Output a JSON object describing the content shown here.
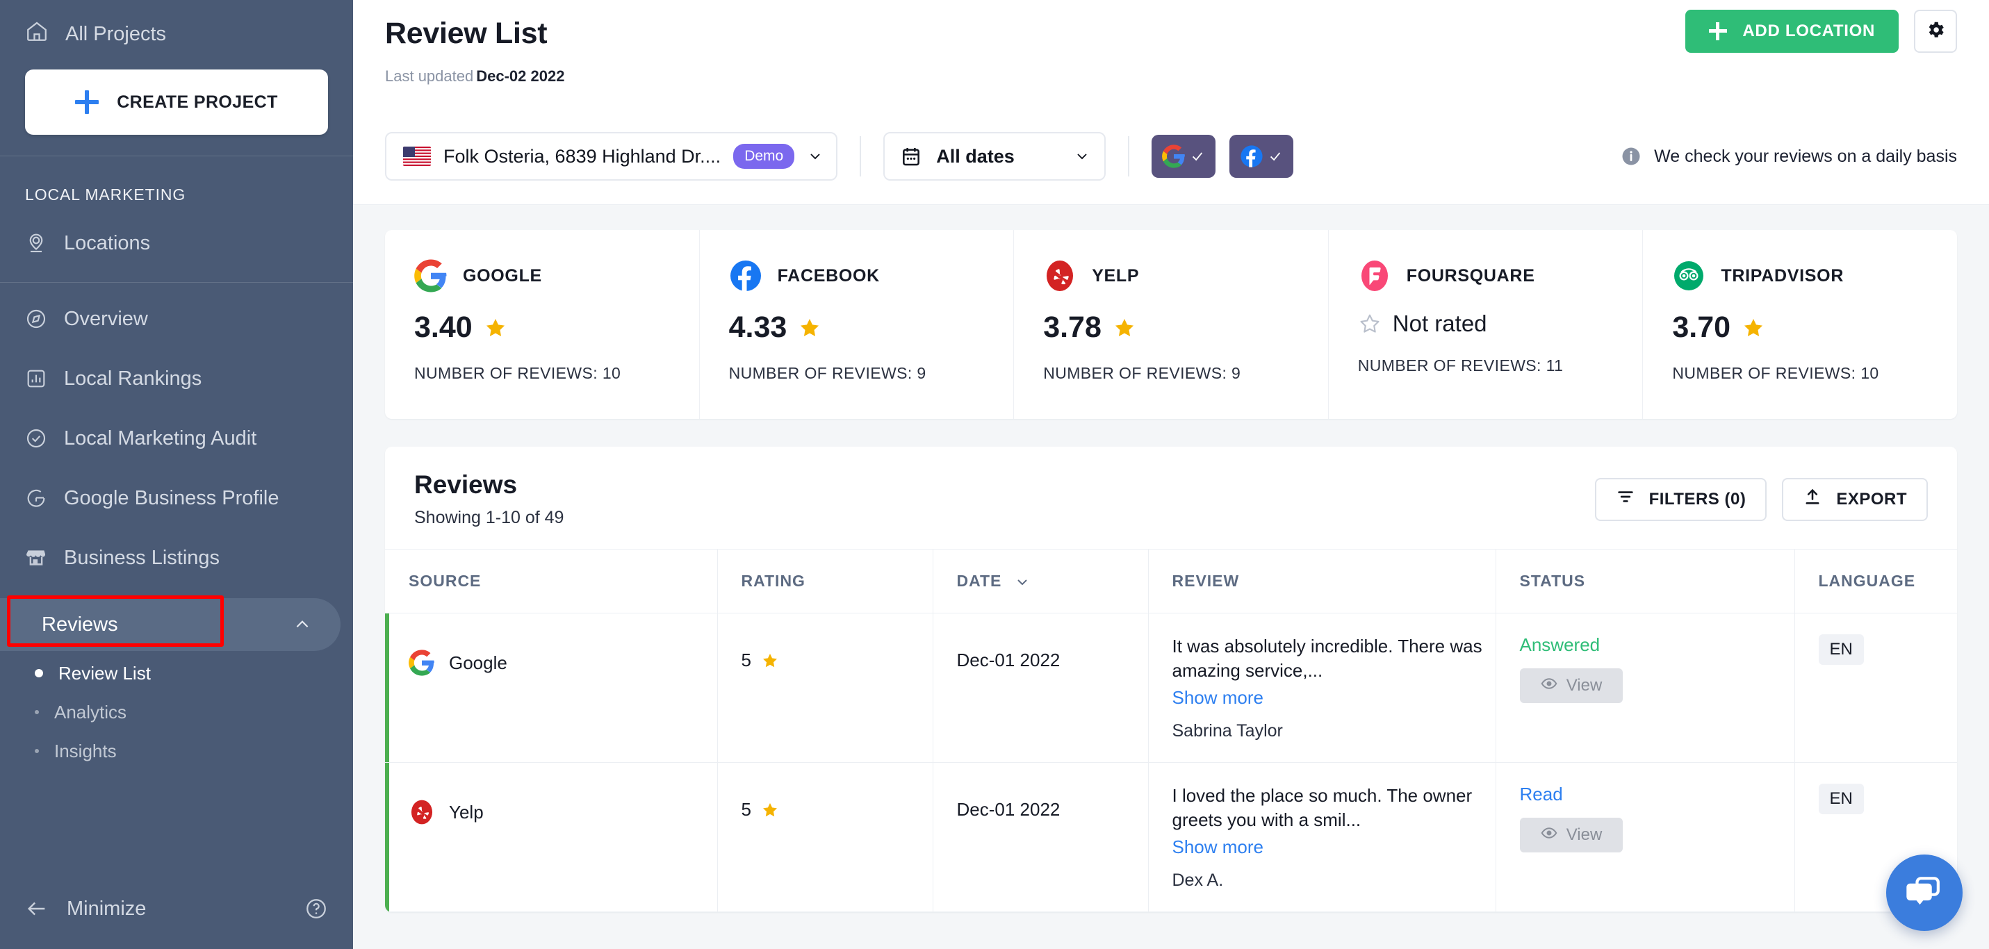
{
  "sidebar": {
    "all_projects": "All Projects",
    "create_project": "CREATE PROJECT",
    "section_label": "LOCAL MARKETING",
    "locations": "Locations",
    "items": [
      {
        "label": "Overview"
      },
      {
        "label": "Local Rankings"
      },
      {
        "label": "Local Marketing Audit"
      },
      {
        "label": "Google Business Profile"
      },
      {
        "label": "Business Listings"
      }
    ],
    "active_item": "Reviews",
    "sub_items": [
      {
        "label": "Review List",
        "current": true
      },
      {
        "label": "Analytics",
        "current": false
      },
      {
        "label": "Insights",
        "current": false
      }
    ],
    "minimize": "Minimize",
    "accent_highlight": "#ff0000"
  },
  "header": {
    "title": "Review List",
    "last_updated_label": "Last updated",
    "last_updated_value": "Dec-02 2022",
    "add_location": "ADD LOCATION",
    "add_location_color": "#2fbd77"
  },
  "filters": {
    "location_name": "Folk Osteria, 6839 Highland Dr....",
    "location_badge": "Demo",
    "location_badge_color": "#7b68ee",
    "date_range": "All dates",
    "sources": [
      {
        "name": "google-source-toggle",
        "checked": true
      },
      {
        "name": "facebook-source-toggle",
        "checked": true
      }
    ],
    "info_note": "We check your reviews on a daily basis"
  },
  "stats": [
    {
      "platform": "GOOGLE",
      "score": "3.40",
      "rated": true,
      "count_label": "NUMBER OF REVIEWS: 10",
      "icon": "google-logo"
    },
    {
      "platform": "FACEBOOK",
      "score": "4.33",
      "rated": true,
      "count_label": "NUMBER OF REVIEWS: 9",
      "icon": "facebook-logo"
    },
    {
      "platform": "YELP",
      "score": "3.78",
      "rated": true,
      "count_label": "NUMBER OF REVIEWS: 9",
      "icon": "yelp-logo"
    },
    {
      "platform": "FOURSQUARE",
      "score": "Not rated",
      "rated": false,
      "count_label": "NUMBER OF REVIEWS: 11",
      "icon": "foursquare-logo"
    },
    {
      "platform": "TRIPADVISOR",
      "score": "3.70",
      "rated": true,
      "count_label": "NUMBER OF REVIEWS: 10",
      "icon": "tripadvisor-logo"
    }
  ],
  "reviews_panel": {
    "title": "Reviews",
    "showing": "Showing 1-10 of 49",
    "filters_button": "FILTERS (0)",
    "export_button": "EXPORT",
    "columns": [
      "SOURCE",
      "RATING",
      "DATE",
      "REVIEW",
      "STATUS",
      "LANGUAGE"
    ],
    "rows": [
      {
        "source": "Google",
        "source_icon": "google-logo",
        "rating": "5",
        "date": "Dec-01 2022",
        "review_text": "It was absolutely incredible. There was amazing service,...",
        "show_more": "Show more",
        "author": "Sabrina Taylor",
        "status": "Answered",
        "status_color": "#2fbd77",
        "view_label": "View",
        "language": "EN"
      },
      {
        "source": "Yelp",
        "source_icon": "yelp-logo",
        "rating": "5",
        "date": "Dec-01 2022",
        "review_text": "I loved the place so much. The owner greets you with a smil...",
        "show_more": "Show more",
        "author": "Dex A.",
        "status": "Read",
        "status_color": "#2d7ff0",
        "view_label": "View",
        "language": "EN"
      }
    ]
  },
  "chat": {
    "name": "chat-widget-button"
  }
}
